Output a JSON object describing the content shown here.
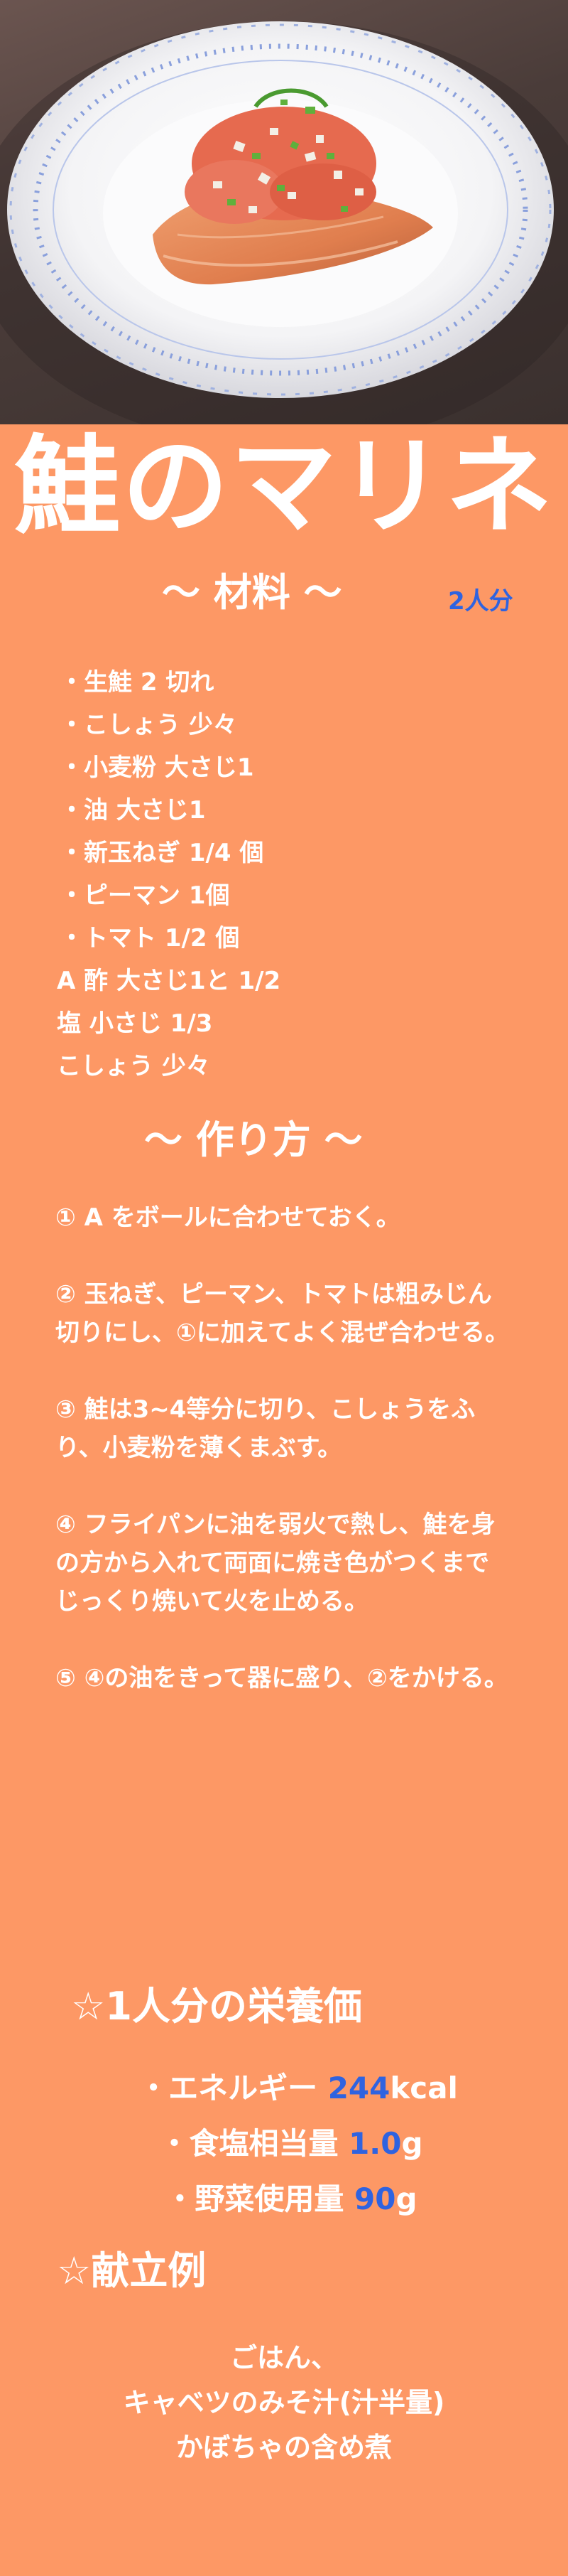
{
  "title": "鮭のマリネ",
  "ingredients_heading": "～ 材料 ～",
  "servings": "2人分",
  "ingredients": [
    "・生鮭 2 切れ",
    "・こしょう 少々",
    "・小麦粉 大さじ1",
    "・油 大さじ1",
    "・新玉ねぎ 1/4 個",
    "・ピーマン 1個",
    "・トマト 1/2 個",
    "A 酢 大さじ1と 1/2",
    "塩 小さじ 1/3",
    "こしょう 少々"
  ],
  "method_heading": "～ 作り方 ～",
  "steps": [
    "① A をボールに合わせておく。",
    "② 玉ねぎ、ピーマン、トマトは粗みじん切りにし、①に加えてよく混ぜ合わせる。",
    "③ 鮭は3~4等分に切り、こしょうをふり、小麦粉を薄くまぶす。",
    "④ フライパンに油を弱火で熱し、鮭を身の方から入れて両面に焼き色がつくまでじっくり焼いて火を止める。",
    "⑤ ④の油をきって器に盛り、②をかける。"
  ],
  "nutrition_heading": "☆1人分の栄養価",
  "nutrition": [
    {
      "label": "・エネルギー ",
      "value": "244",
      "unit": "kcal"
    },
    {
      "label": "・食塩相当量 ",
      "value": "1.0",
      "unit": "g"
    },
    {
      "label": "・野菜使用量 ",
      "value": "90",
      "unit": "g"
    }
  ],
  "menu_heading": "☆献立例",
  "menu": [
    "ごはん、",
    "キャベツのみそ汁(汁半量)",
    "かぼちゃの含め煮"
  ],
  "colors": {
    "background": "#fd9865",
    "text": "#ffffff",
    "accent": "#2f63e0"
  }
}
